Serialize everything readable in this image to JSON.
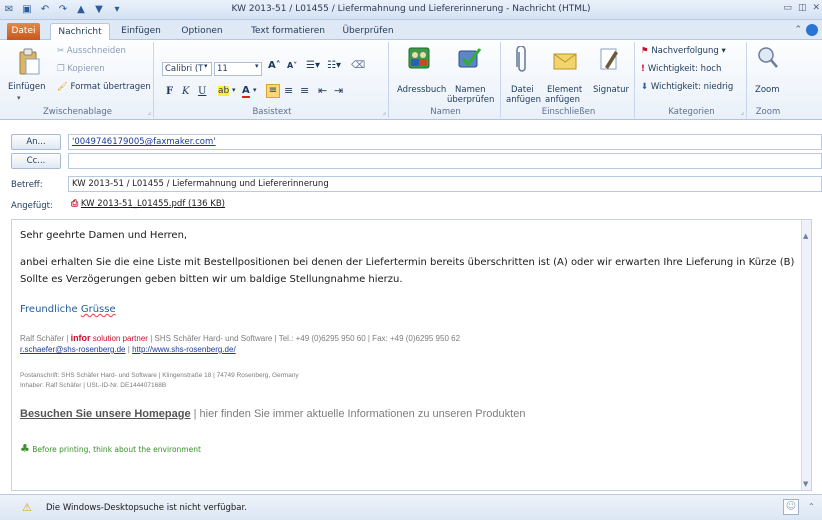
{
  "window": {
    "title": "KW 2013-51 / L01455 / Liefermahnung und Liefererinnerung  -  Nachricht (HTML)"
  },
  "tabs": [
    {
      "label": "Datei"
    },
    {
      "label": "Nachricht"
    },
    {
      "label": "Einfügen"
    },
    {
      "label": "Optionen"
    },
    {
      "label": "Text formatieren"
    },
    {
      "label": "Überprüfen"
    }
  ],
  "ribbon": {
    "clipboard": {
      "paste": "Einfügen",
      "cut": "Ausschneiden",
      "copy": "Kopieren",
      "format_painter": "Format übertragen",
      "group": "Zwischenablage"
    },
    "basictext": {
      "font": "Calibri (T",
      "size": "11",
      "group": "Basistext"
    },
    "names": {
      "addressbook": "Adressbuch",
      "check_line1": "Namen",
      "check_line2": "überprüfen",
      "group": "Namen"
    },
    "include": {
      "file_line1": "Datei",
      "file_line2": "anfügen",
      "element_line1": "Element",
      "element_line2": "anfügen",
      "signature": "Signatur",
      "group": "Einschließen"
    },
    "tags": {
      "followup": "Nachverfolgung",
      "high": "Wichtigkeit: hoch",
      "low": "Wichtigkeit: niedrig",
      "group": "Kategorien"
    },
    "zoom": {
      "label": "Zoom",
      "group": "Zoom"
    }
  },
  "header": {
    "to_button": "An...",
    "to_value": "'0049746179005@faxmaker.com'",
    "cc_button": "Cc...",
    "subject_label": "Betreff:",
    "subject_value": "KW 2013-51 / L01455 / Liefermahnung und Liefererinnerung",
    "attached_label": "Angefügt:",
    "attachment": "KW 2013-51_L01455.pdf (136 KB)"
  },
  "body": {
    "greeting": "Sehr geehrte Damen und Herren,",
    "line1": "anbei erhalten Sie die eine Liste mit Bestellpositionen bei denen der Liefertermin bereits überschritten ist (A) oder wir erwarten Ihre Lieferung in Kürze (B)",
    "line2": "Sollte es Verzögerungen geben bitten wir um baldige Stellungnahme hierzu.",
    "closing_word1": "Freundliche",
    "closing_word2": "Grüsse",
    "sig_name": "Ralf Schäfer |",
    "sig_brand_bold": "infor",
    "sig_brand_rest": "solution partner",
    "sig_rest": "| SHS Schäfer Hard- und Software | Tel.: +49 (0)6295 950 60 | Fax: +49 (0)6295 950 62",
    "sig_email": "r.schaefer@shs-rosenberg.de",
    "sig_sep": "|",
    "sig_web": "http://www.shs-rosenberg.de/",
    "postal": "Postanschrift: SHS Schäfer Hard- und Software | Klingenstraße 18 | 74749 Rosenberg, Germany",
    "owner": "Inhaber: Ralf Schäfer  | USt.-ID-Nr. DE144407168B",
    "homepage_link": "Besuchen Sie unsere Homepage",
    "homepage_rest": "| hier finden Sie immer aktuelle Informationen zu unseren Produkten",
    "eco": "Before printing, think about the environment"
  },
  "status": {
    "message": "Die Windows-Desktopsuche ist nicht verfügbar."
  },
  "colors": {
    "file_tab": "#c8571c",
    "link": "#1a3a9e",
    "eco_green": "#3a8f2a",
    "infor_red": "#c8102e"
  }
}
